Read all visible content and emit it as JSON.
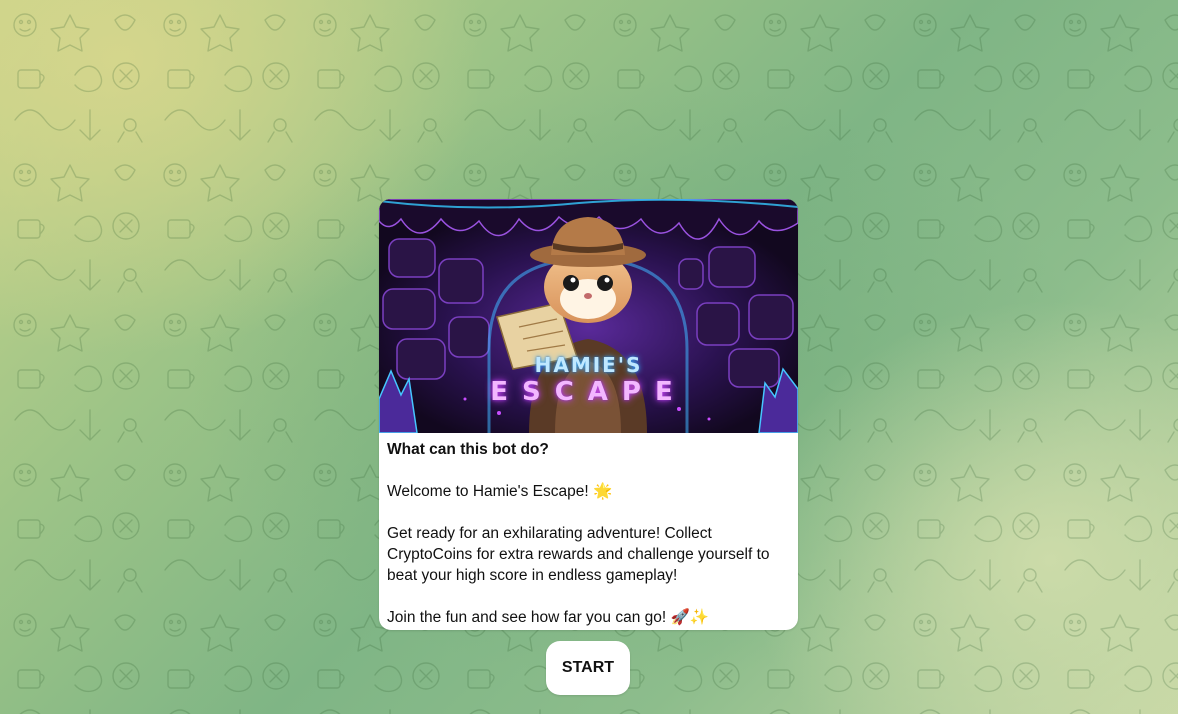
{
  "colors": {
    "background_start": "#c9d48a",
    "background_mid": "#7fb585",
    "background_end": "#c8d8a6",
    "card_bg": "#ffffff",
    "banner_bg": "#160c28",
    "banner_neon_blue": "#3fb7ff",
    "banner_neon_pink": "#d54dff"
  },
  "bot_info": {
    "banner": {
      "title_line_1": "HAMIE'S",
      "title_line_2": "ESCAPE",
      "illustration": "hamster-explorer-with-map"
    },
    "heading": "What can this bot do?",
    "welcome": "Welcome to Hamie's Escape! 🌟",
    "description": "Get ready for an exhilarating adventure! Collect CryptoCoins for extra rewards and challenge yourself to beat your high score in endless gameplay!",
    "closing": "Join the fun and see how far you can go! 🚀✨"
  },
  "start_button": {
    "label": "START"
  }
}
